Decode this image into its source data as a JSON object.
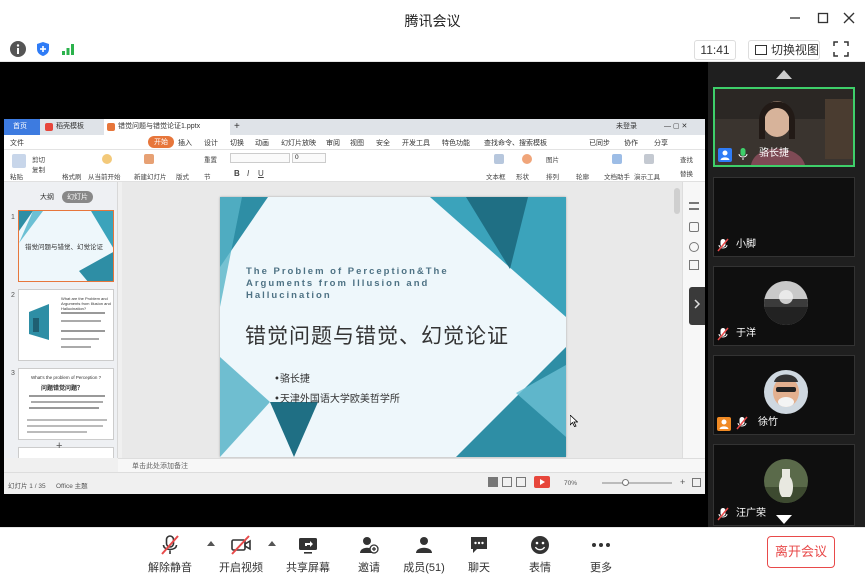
{
  "app": {
    "title": "腾讯会议",
    "time": "11:41",
    "switch_view_label": "切换视图"
  },
  "ppt": {
    "tabs": [
      {
        "label": "首页"
      },
      {
        "label": "稻壳模板"
      },
      {
        "label": "错觉问题与错觉论证1.pptx"
      }
    ],
    "login_label": "未登录",
    "menu": {
      "file": "文件",
      "start": "开始",
      "insert": "插入",
      "design": "设计",
      "transition": "切换",
      "animation": "动画",
      "slideshow": "幻灯片放映",
      "review": "审阅",
      "view": "视图",
      "security": "安全",
      "dev": "开发工具",
      "special": "特色功能",
      "search": "查找命令、搜索模板",
      "sync": "已同步",
      "collab": "协作",
      "share": "分享"
    },
    "ribbon": {
      "paste": "粘贴",
      "cut": "剪切",
      "copy": "复制",
      "format_painter": "格式刷",
      "from_current": "从当前开始",
      "new_slide": "新建幻灯片",
      "layout": "版式",
      "section": "节",
      "reset": "重置",
      "font_size": "0",
      "textbox": "文本框",
      "shape": "形状",
      "arrange": "排列",
      "image": "图片",
      "outline": "轮廓",
      "doc_helper": "文档助手",
      "present_tools": "演示工具",
      "find": "查找",
      "replace": "替换"
    },
    "panel_tabs": {
      "outline": "大纲",
      "slides": "幻灯片"
    },
    "thumbs": [
      {
        "num": "1",
        "title": "错觉问题与错觉、幻觉论证"
      },
      {
        "num": "2",
        "text": "What are the Problem and Arguments from Illusion and Hallucination?"
      },
      {
        "num": "3",
        "title": "问题错觉问题？",
        "text": "What's the problem of Perception ?"
      }
    ],
    "slide": {
      "title_en": "The Problem of Perception&The Arguments from Illusion and Hallucination",
      "title_cn": "错觉问题与错觉、幻觉论证",
      "bullet1": "•骆长捷",
      "bullet2": "•天津外国语大学欧美哲学所"
    },
    "notes_placeholder": "单击此处添加备注",
    "status": {
      "slide_counter": "幻灯片 1 / 35",
      "theme": "Office 主题",
      "zoom": "70%"
    }
  },
  "participants": [
    {
      "name": "骆长捷",
      "speaking": true
    },
    {
      "name": "小脚",
      "speaking": false
    },
    {
      "name": "于洋",
      "speaking": false
    },
    {
      "name": "徐竹",
      "speaking": false
    },
    {
      "name": "汪广荣",
      "speaking": false
    }
  ],
  "toolbar": {
    "mute": "解除静音",
    "video": "开启视频",
    "share": "共享屏幕",
    "invite": "邀请",
    "members": "成员(51)",
    "chat": "聊天",
    "emoji": "表情",
    "more": "更多",
    "leave": "离开会议"
  },
  "colors": {
    "accent_teal": "#2e8ea5",
    "ppt_orange": "#e7763b",
    "leave_red": "#e84a4a",
    "speaking_green": "#3ecf6a"
  }
}
